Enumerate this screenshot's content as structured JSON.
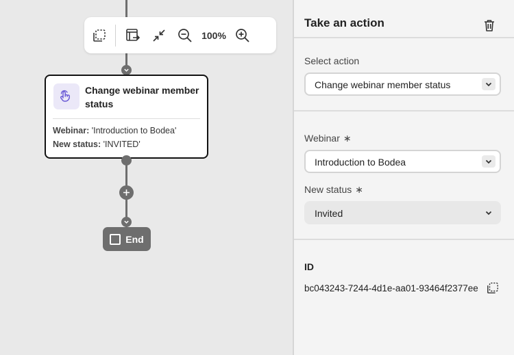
{
  "canvas": {
    "toolbar": {
      "zoom_label": "100%",
      "icons": [
        "select-area-icon",
        "auto-layout-icon",
        "collapse-icon",
        "zoom-out-icon",
        "zoom-in-icon"
      ]
    },
    "node": {
      "title": "Change webinar member status",
      "webinar_key": "Webinar:",
      "webinar_value": "'Introduction to Bodea'",
      "status_key": "New status:",
      "status_value": "'INVITED'",
      "icon": "touch-hand-icon",
      "accent": "#6b5bd6"
    },
    "end_node": {
      "label": "End"
    }
  },
  "panel": {
    "title": "Take an action",
    "select_action": {
      "label": "Select action",
      "value": "Change webinar member status"
    },
    "webinar": {
      "label": "Webinar",
      "required_mark": "∗",
      "value": "Introduction to Bodea"
    },
    "new_status": {
      "label": "New status",
      "required_mark": "∗",
      "value": "Invited"
    },
    "id": {
      "label": "ID",
      "value": "bc043243-7244-4d1e-aa01-93464f2377ee"
    }
  }
}
